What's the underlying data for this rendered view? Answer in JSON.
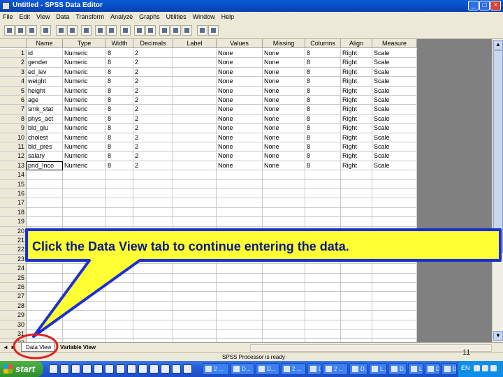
{
  "window": {
    "title": "Untitled - SPSS Data Editor",
    "controls": [
      "_",
      "□",
      "×"
    ]
  },
  "menu": [
    "File",
    "Edit",
    "View",
    "Data",
    "Transform",
    "Analyze",
    "Graphs",
    "Utilities",
    "Window",
    "Help"
  ],
  "grid": {
    "headers": [
      "Name",
      "Type",
      "Width",
      "Decimals",
      "Label",
      "Values",
      "Missing",
      "Columns",
      "Align",
      "Measure"
    ],
    "rows": [
      [
        "id",
        "Numeric",
        "8",
        "2",
        "",
        "None",
        "None",
        "8",
        "Right",
        "Scale"
      ],
      [
        "gender",
        "Numeric",
        "8",
        "2",
        "",
        "None",
        "None",
        "8",
        "Right",
        "Scale"
      ],
      [
        "ed_lev",
        "Numeric",
        "8",
        "2",
        "",
        "None",
        "None",
        "8",
        "Right",
        "Scale"
      ],
      [
        "weight",
        "Numeric",
        "8",
        "2",
        "",
        "None",
        "None",
        "8",
        "Right",
        "Scale"
      ],
      [
        "height",
        "Numeric",
        "8",
        "2",
        "",
        "None",
        "None",
        "8",
        "Right",
        "Scale"
      ],
      [
        "age",
        "Numeric",
        "8",
        "2",
        "",
        "None",
        "None",
        "8",
        "Right",
        "Scale"
      ],
      [
        "smk_stat",
        "Numeric",
        "8",
        "2",
        "",
        "None",
        "None",
        "8",
        "Right",
        "Scale"
      ],
      [
        "phys_act",
        "Numeric",
        "8",
        "2",
        "",
        "None",
        "None",
        "8",
        "Right",
        "Scale"
      ],
      [
        "bld_glu",
        "Numeric",
        "8",
        "2",
        "",
        "None",
        "None",
        "8",
        "Right",
        "Scale"
      ],
      [
        "cholest",
        "Numeric",
        "8",
        "2",
        "",
        "None",
        "None",
        "8",
        "Right",
        "Scale"
      ],
      [
        "bld_pres",
        "Numeric",
        "8",
        "2",
        "",
        "None",
        "None",
        "8",
        "Right",
        "Scale"
      ],
      [
        "salary",
        "Numeric",
        "8",
        "2",
        "",
        "None",
        "None",
        "8",
        "Right",
        "Scale"
      ],
      [
        "pnd_Inco",
        "Numeric",
        "8",
        "2",
        "",
        "None",
        "None",
        "8",
        "Right",
        "Scale"
      ]
    ],
    "row_numbers": [
      "1",
      "2",
      "3",
      "4",
      "5",
      "6",
      "7",
      "8",
      "9",
      "10",
      "11",
      "12",
      "13",
      "14",
      "15",
      "16",
      "17",
      "18",
      "19",
      "20",
      "21",
      "22",
      "23",
      "24",
      "25",
      "26",
      "27",
      "28",
      "29",
      "30",
      "31",
      "32"
    ]
  },
  "tabs": {
    "data_view": "Data View",
    "variable_view": "Variable View",
    "nav": [
      "◄",
      "►"
    ]
  },
  "status": {
    "text": "SPSS Processor  is ready",
    "slide_number": "11"
  },
  "taskbar": {
    "start": "start",
    "tasks": [
      "2 ...",
      "D...",
      "D...",
      "2 ...",
      "D...",
      "2 ...",
      "D...",
      "L...",
      "D...",
      "L...",
      "D...",
      "D...",
      "U..."
    ],
    "lang": "EN"
  },
  "callout": {
    "text": "Click the Data View tab to continue entering the data.",
    "fill_color": "#ffff33",
    "border_color": "#1c2fd6",
    "ring_color": "#e02020"
  }
}
